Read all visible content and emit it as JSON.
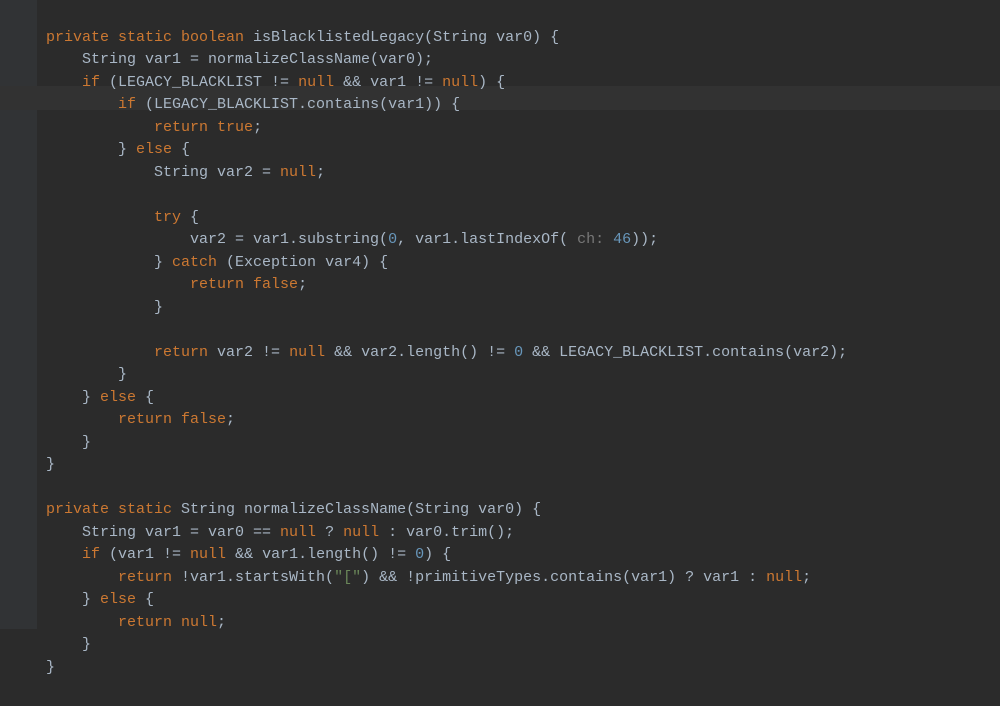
{
  "code": {
    "l1": {
      "kw1": "private static boolean",
      "name": " isBlacklistedLegacy(String var0) {"
    },
    "l2": {
      "pre": "    String var1 = normalizeClassName(var0);"
    },
    "l3": {
      "kw1": "if",
      "txt1": " (LEGACY_BLACKLIST != ",
      "kw2": "null",
      "txt2": " && var1 != ",
      "kw3": "null",
      "txt3": ") {"
    },
    "l4": {
      "kw1": "if",
      "txt1": " (LEGACY_BLACKLIST.contains(var1)) {"
    },
    "l5": {
      "kw1": "return true",
      "txt1": ";"
    },
    "l6": {
      "txt1": "        } ",
      "kw1": "else",
      "txt2": " {"
    },
    "l7": {
      "txt1": "            String var2 = ",
      "kw1": "null",
      "txt2": ";"
    },
    "l8": "",
    "l9": {
      "kw1": "try",
      "txt1": " {"
    },
    "l10": {
      "txt1": "                var2 = var1.substring(",
      "num1": "0",
      "txt2": ", var1.lastIndexOf(",
      "hint": " ch: ",
      "num2": "46",
      "txt3": "));"
    },
    "l11": {
      "txt1": "            } ",
      "kw1": "catch",
      "txt2": " (Exception var4) {"
    },
    "l12": {
      "kw1": "return false",
      "txt1": ";"
    },
    "l13": "            }",
    "l14": "",
    "l15": {
      "kw1": "return",
      "txt1": " var2 != ",
      "kw2": "null",
      "txt2": " && var2.length() != ",
      "num1": "0",
      "txt3": " && LEGACY_BLACKLIST.contains(var2);"
    },
    "l16": "        }",
    "l17": {
      "txt1": "    } ",
      "kw1": "else",
      "txt2": " {"
    },
    "l18": {
      "kw1": "return false",
      "txt1": ";"
    },
    "l19": "    }",
    "l20": "}",
    "l21": "",
    "l22": {
      "kw1": "private static",
      "txt1": " String normalizeClassName(String var0) {"
    },
    "l23": {
      "txt1": "    String var1 = var0 == ",
      "kw1": "null",
      "txt2": " ? ",
      "kw2": "null",
      "txt3": " : var0.trim();"
    },
    "l24": {
      "kw1": "if",
      "txt1": " (var1 != ",
      "kw2": "null",
      "txt2": " && var1.length() != ",
      "num1": "0",
      "txt3": ") {"
    },
    "l25": {
      "kw1": "return",
      "txt1": " !var1.startsWith(",
      "str1": "\"[\"",
      "txt2": ") && !primitiveTypes.contains(var1) ? var1 : ",
      "kw2": "null",
      "txt3": ";"
    },
    "l26": {
      "txt1": "    } ",
      "kw1": "else",
      "txt2": " {"
    },
    "l27": {
      "kw1": "return null",
      "txt1": ";"
    },
    "l28": "    }",
    "l29": "}"
  },
  "icons": {
    "bulb": "lightbulb-icon"
  }
}
